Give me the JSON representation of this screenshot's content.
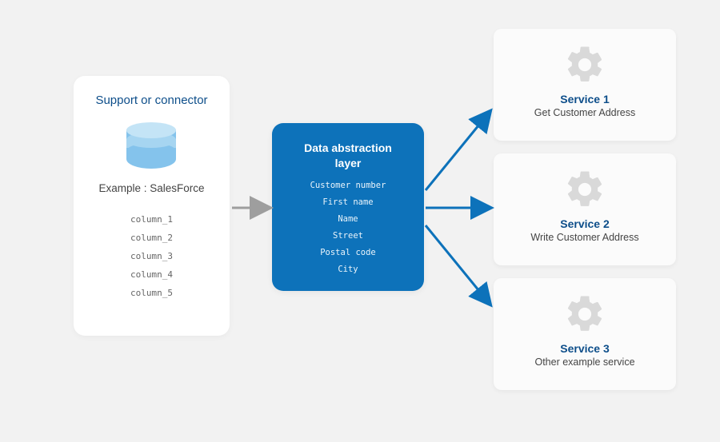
{
  "colors": {
    "accent": "#0d72ba",
    "link_text": "#0d4e8a"
  },
  "source": {
    "title": "Support or connector",
    "example_label": "Example : SalesForce",
    "columns": [
      "column_1",
      "column_2",
      "column_3",
      "column_4",
      "column_5"
    ],
    "icon": "database-icon"
  },
  "abstraction": {
    "title": "Data abstraction layer",
    "fields": [
      "Customer number",
      "First name",
      "Name",
      "Street",
      "Postal code",
      "City"
    ]
  },
  "services": [
    {
      "name": "Service 1",
      "desc": "Get Customer Address",
      "icon": "gear-icon"
    },
    {
      "name": "Service 2",
      "desc": "Write Customer Address",
      "icon": "gear-icon"
    },
    {
      "name": "Service 3",
      "desc": "Other example service",
      "icon": "gear-icon"
    }
  ],
  "arrows": {
    "source_to_abstraction": true,
    "abstraction_to_services": 3
  }
}
